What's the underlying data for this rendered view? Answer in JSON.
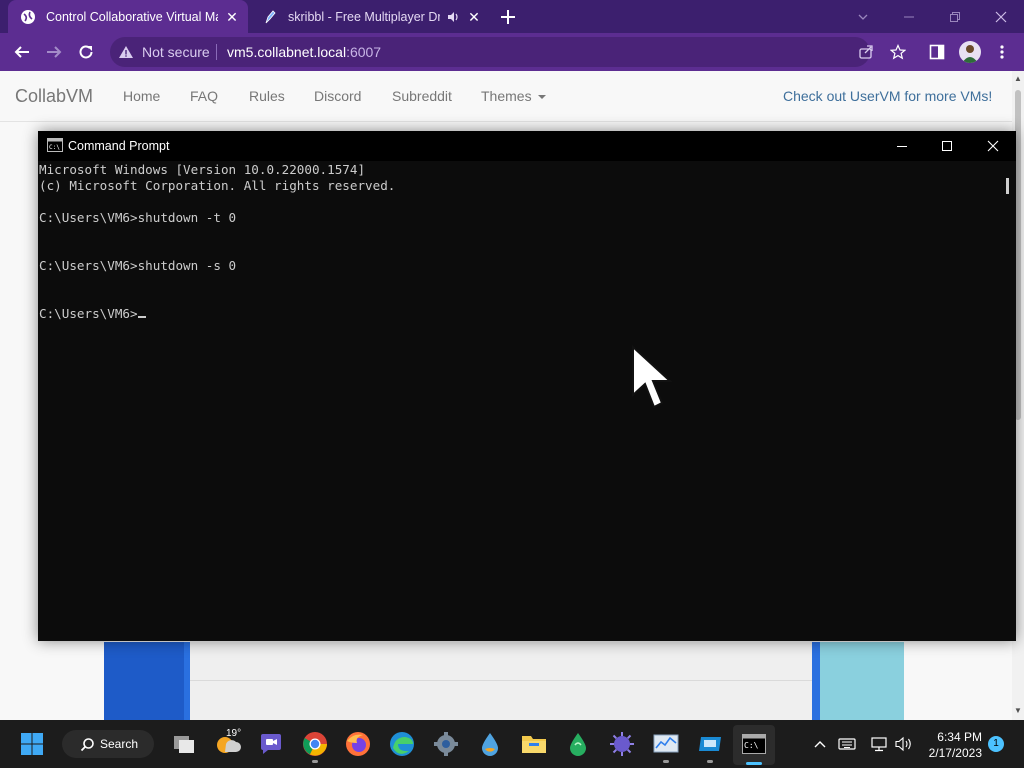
{
  "browser": {
    "tabs": [
      {
        "title": "Control Collaborative Virtual Machines!",
        "active": true
      },
      {
        "title": "skribbl - Free Multiplayer Drawing & Guessing Game",
        "active": false,
        "audio": true
      }
    ],
    "new_tab_icon": "plus-icon",
    "security_label": "Not secure",
    "url_host": "vm5.collabnet.local",
    "url_port": ":6007"
  },
  "site": {
    "brand": "CollabVM",
    "nav": [
      "Home",
      "FAQ",
      "Rules",
      "Discord",
      "Subreddit",
      "Themes"
    ],
    "promo": "Check out UserVM for more VMs!"
  },
  "cmd": {
    "title": "Command Prompt",
    "lines": [
      "Microsoft Windows [Version 10.0.22000.1574]",
      "(c) Microsoft Corporation. All rights reserved.",
      "",
      "C:\\Users\\VM6>shutdown -t 0",
      "",
      "",
      "C:\\Users\\VM6>shutdown -s 0",
      "",
      "",
      "C:\\Users\\VM6>"
    ]
  },
  "taskbar": {
    "search_label": "Search",
    "weather_temp": "19°",
    "clock_time": "6:34 PM",
    "clock_date": "2/17/2023",
    "notification_count": "1"
  },
  "colors": {
    "chrome_frame": "#3c1f6e",
    "chrome_toolbar": "#5c2d91",
    "cmd_bg": "#0c0c0c",
    "taskbar_bg": "#1c1c1c",
    "accent": "#4cc2ff"
  }
}
